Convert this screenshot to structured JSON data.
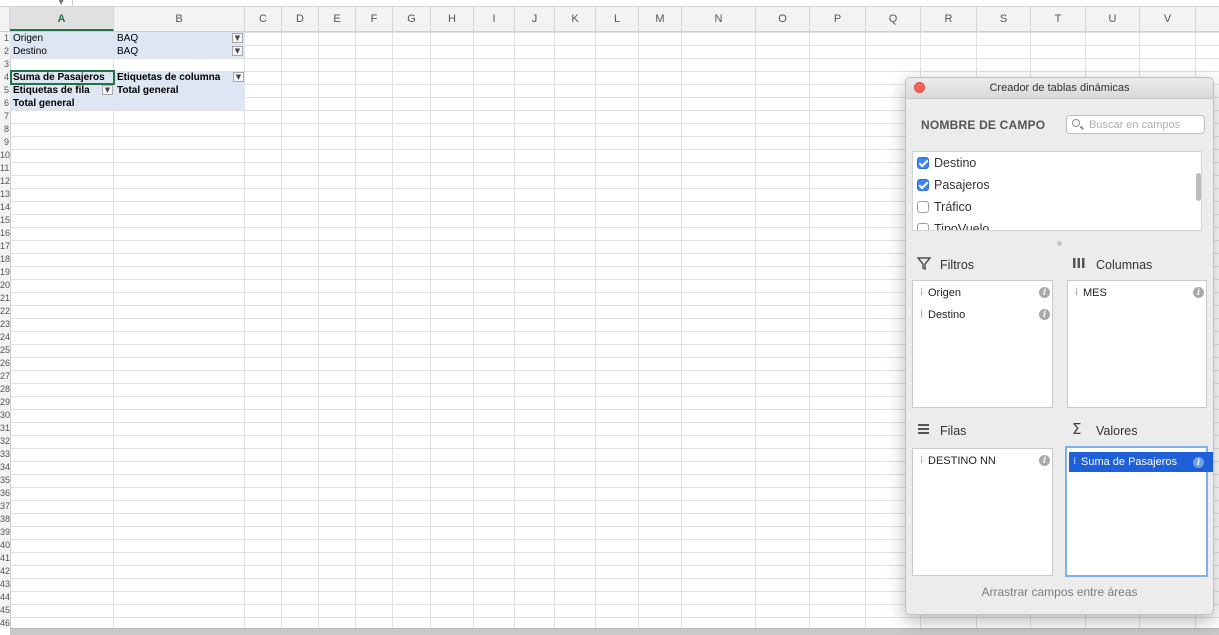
{
  "columns": [
    "A",
    "B",
    "C",
    "D",
    "E",
    "F",
    "G",
    "H",
    "I",
    "J",
    "K",
    "L",
    "M",
    "N",
    "O",
    "P",
    "Q",
    "R",
    "S",
    "T",
    "U",
    "V"
  ],
  "row_numbers": [
    "1",
    "2",
    "3",
    "4",
    "5",
    "6",
    "7",
    "8",
    "9",
    "10",
    "11",
    "12",
    "13",
    "14",
    "15",
    "16",
    "17",
    "18",
    "19",
    "20",
    "21",
    "22",
    "23",
    "24",
    "25",
    "26",
    "27",
    "28",
    "29",
    "30",
    "31",
    "32",
    "33",
    "34",
    "35",
    "36",
    "37",
    "38",
    "39",
    "40",
    "41",
    "42",
    "43",
    "44",
    "45",
    "46"
  ],
  "sheet": {
    "filter_origen_label": "Origen",
    "filter_origen_value": "BAQ",
    "filter_destino_label": "Destino",
    "filter_destino_value": "BAQ",
    "sum_label": "Suma de Pasajeros",
    "column_labels": "Etiquetas de columna",
    "row_labels": "Etiquetas de fila",
    "total_general_col": "Total general",
    "total_general_row": "Total general"
  },
  "panel": {
    "title": "Creador de tablas dinámicas",
    "field_header": "NOMBRE DE CAMPO",
    "search_placeholder": "Buscar en campos",
    "fields": [
      {
        "label": "Destino",
        "checked": true
      },
      {
        "label": "Pasajeros",
        "checked": true
      },
      {
        "label": "Tráfico",
        "checked": false
      },
      {
        "label": "TipoVuelo",
        "checked": false
      }
    ],
    "filtros_label": "Filtros",
    "columnas_label": "Columnas",
    "filas_label": "Filas",
    "valores_label": "Valores",
    "filtros_items": [
      "Origen",
      "Destino"
    ],
    "columnas_items": [
      "MES"
    ],
    "filas_items": [
      "DESTINO NN"
    ],
    "valores_items": [
      "Suma de Pasajeros"
    ],
    "drag_hint": "Arrastrar campos entre áreas"
  }
}
